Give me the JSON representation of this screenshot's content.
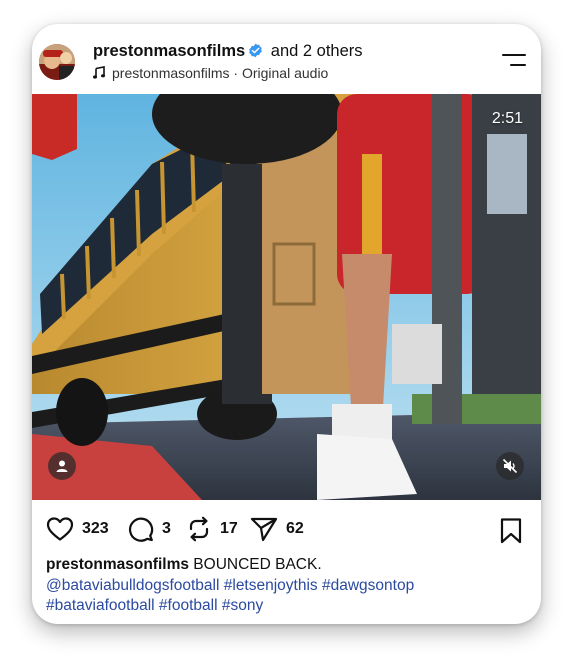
{
  "post": {
    "username": "prestonmasonfilms",
    "collab_text": "and 2 others",
    "audio_owner": "prestonmasonfilms",
    "audio_separator": " · ",
    "audio_label": "Original audio",
    "video_timer": "2:51",
    "icons": {
      "verified": "verified-badge-icon",
      "audio": "music-note-icon",
      "menu": "menu-icon",
      "user_tags": "user-tag-icon",
      "mute": "muted-speaker-icon"
    },
    "colors": {
      "verified_badge": "#3897f0",
      "hashtag": "#2b4aa0"
    }
  },
  "actions": {
    "likes": "323",
    "comments": "3",
    "reposts": "17",
    "shares": "62"
  },
  "caption": {
    "username": "prestonmasonfilms",
    "text": "BOUNCED BACK.",
    "tags": [
      "@bataviabulldogsfootball",
      "#letsenjoythis",
      "#dawgsontop",
      "#bataviafootball",
      "#football",
      "#sony"
    ]
  }
}
